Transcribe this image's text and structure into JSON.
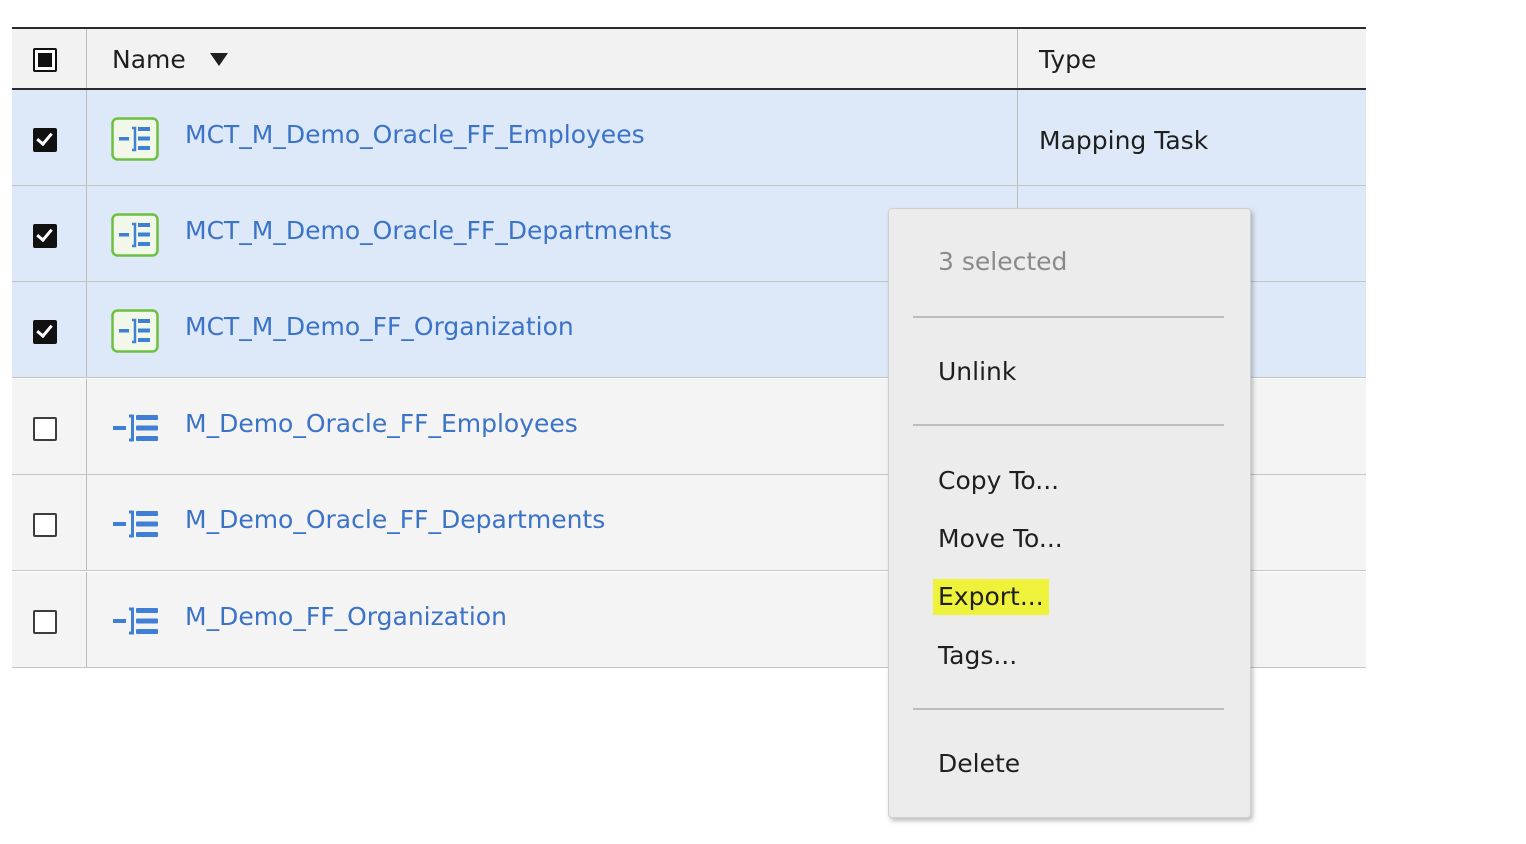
{
  "table": {
    "columns": {
      "name": "Name",
      "type": "Type"
    },
    "rows": [
      {
        "name": "MCT_M_Demo_Oracle_FF_Employees",
        "type": "Mapping Task",
        "selected": true,
        "icon": "mapping-task-icon"
      },
      {
        "name": "MCT_M_Demo_Oracle_FF_Departments",
        "type": "",
        "selected": true,
        "icon": "mapping-task-icon"
      },
      {
        "name": "MCT_M_Demo_FF_Organization",
        "type": "",
        "selected": true,
        "icon": "mapping-task-icon"
      },
      {
        "name": "M_Demo_Oracle_FF_Employees",
        "type": "",
        "selected": false,
        "icon": "mapping-icon"
      },
      {
        "name": "M_Demo_Oracle_FF_Departments",
        "type": "",
        "selected": false,
        "icon": "mapping-icon"
      },
      {
        "name": "M_Demo_FF_Organization",
        "type": "",
        "selected": false,
        "icon": "mapping-icon"
      }
    ]
  },
  "context_menu": {
    "caption": "3 selected",
    "items": {
      "unlink": "Unlink",
      "copy_to": "Copy To...",
      "move_to": "Move To...",
      "export": "Export...",
      "tags": "Tags...",
      "delete": "Delete"
    }
  },
  "colors": {
    "link": "#3b73c8",
    "selected_row": "#dde9f8",
    "highlight": "#eef23a",
    "task_icon_border": "#6cbf3f"
  }
}
